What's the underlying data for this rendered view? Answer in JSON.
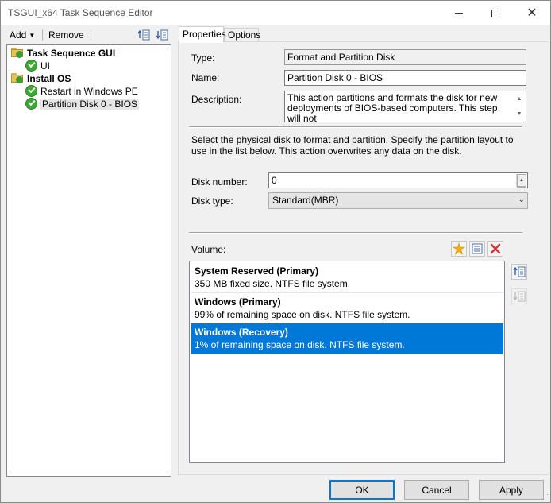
{
  "window": {
    "title": "TSGUI_x64 Task Sequence Editor"
  },
  "toolbar": {
    "add_label": "Add",
    "remove_label": "Remove"
  },
  "tree": {
    "nodes": [
      {
        "label": "Task Sequence GUI",
        "type": "group"
      },
      {
        "label": "UI",
        "type": "step"
      },
      {
        "label": "Install OS",
        "type": "group"
      },
      {
        "label": "Restart in Windows PE",
        "type": "step"
      },
      {
        "label": "Partition Disk 0 - BIOS",
        "type": "step",
        "selected": true
      }
    ]
  },
  "tabs": [
    {
      "label": "Properties",
      "active": true
    },
    {
      "label": "Options",
      "active": false
    }
  ],
  "properties": {
    "type_label": "Type:",
    "type_value": "Format and Partition Disk",
    "name_label": "Name:",
    "name_value": "Partition Disk 0 - BIOS",
    "description_label": "Description:",
    "description_value": "This action partitions and formats the disk for new deployments of BIOS-based computers. This step will not",
    "info_text": "Select the physical disk to format and partition. Specify the partition layout to use in the list below. This action overwrites any data on the disk.",
    "disk_number_label": "Disk number:",
    "disk_number_value": "0",
    "disk_type_label": "Disk type:",
    "disk_type_value": "Standard(MBR)",
    "volume_label": "Volume:"
  },
  "volumes": [
    {
      "title": "System Reserved (Primary)",
      "detail": "350 MB fixed size. NTFS file system.",
      "selected": false
    },
    {
      "title": "Windows (Primary)",
      "detail": "99% of remaining space on disk. NTFS file system.",
      "selected": false
    },
    {
      "title": "Windows (Recovery)",
      "detail": "1% of remaining space on disk. NTFS file system.",
      "selected": true
    }
  ],
  "buttons": {
    "ok": "OK",
    "cancel": "Cancel",
    "apply": "Apply"
  },
  "colors": {
    "selection": "#0078d7",
    "success": "#3da832",
    "delete": "#d13438"
  }
}
